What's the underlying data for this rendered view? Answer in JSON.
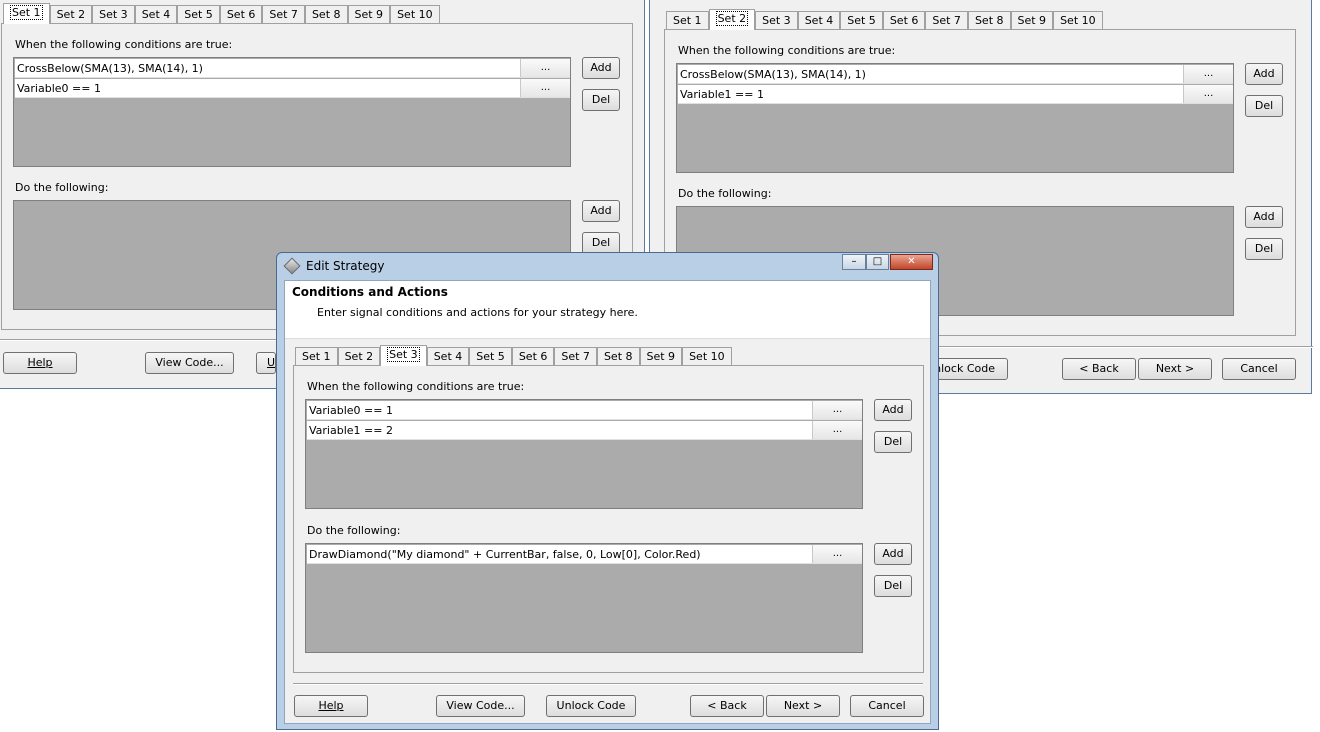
{
  "tabs": [
    "Set 1",
    "Set 2",
    "Set 3",
    "Set 4",
    "Set 5",
    "Set 6",
    "Set 7",
    "Set 8",
    "Set 9",
    "Set 10"
  ],
  "labels": {
    "conditions": "When the following conditions are true:",
    "actions": "Do the following:"
  },
  "buttons": {
    "add": "Add",
    "del": "Del",
    "ellipsis": "...",
    "help": "Help",
    "view_code": "View Code...",
    "unlock_code": "Unlock Code",
    "unlock_code_partial": "nlock Code",
    "back": "< Back",
    "next": "Next >",
    "cancel": "Cancel",
    "partial_u": "U"
  },
  "left_window": {
    "selected_tab": "Set 1",
    "conditions": [
      "CrossBelow(SMA(13), SMA(14), 1)",
      "Variable0 == 1"
    ]
  },
  "right_window": {
    "selected_tab": "Set 2",
    "conditions": [
      "CrossBelow(SMA(13), SMA(14), 1)",
      "Variable1 == 1"
    ]
  },
  "dialog": {
    "title": "Edit Strategy",
    "header_title": "Conditions and Actions",
    "header_subtitle": "Enter signal conditions and actions for your strategy here.",
    "selected_tab": "Set 3",
    "conditions": [
      "Variable0 == 1",
      "Variable1 == 2"
    ],
    "actions": [
      "DrawDiamond(\"My diamond\" + CurrentBar, false, 0, Low[0], Color.Red)"
    ],
    "controls": {
      "minimize": "–",
      "maximize": "□",
      "close": "✕"
    }
  }
}
